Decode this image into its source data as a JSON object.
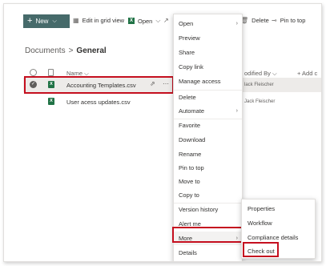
{
  "toolbar": {
    "new_label": "New",
    "edit_grid_label": "Edit in grid view",
    "open_label": "Open",
    "delete_label": "Delete",
    "pin_label": "Pin to top"
  },
  "breadcrumb": {
    "root": "Documents",
    "separator": ">",
    "current": "General"
  },
  "list": {
    "col_name": "Name",
    "col_modified_by": "odified By",
    "col_add": "+ Add c",
    "rows": [
      {
        "name": "Accounting Templates.csv",
        "modified_by": "lack Fleischer"
      },
      {
        "name": "User acess updates.csv",
        "modified_by": "Jack Fleischer"
      }
    ]
  },
  "context_menu": {
    "items": [
      "Open",
      "Preview",
      "Share",
      "Copy link",
      "Manage access",
      "Delete",
      "Automate",
      "Favorite",
      "Download",
      "Rename",
      "Pin to top",
      "Move to",
      "Copy to",
      "Version history",
      "Alert me",
      "More",
      "Details"
    ]
  },
  "submenu": {
    "items": [
      "Properties",
      "Workflow",
      "Compliance details",
      "Check out"
    ]
  },
  "colors": {
    "accent": "#466a6a",
    "highlight": "#c50f1f",
    "excel": "#217346"
  }
}
